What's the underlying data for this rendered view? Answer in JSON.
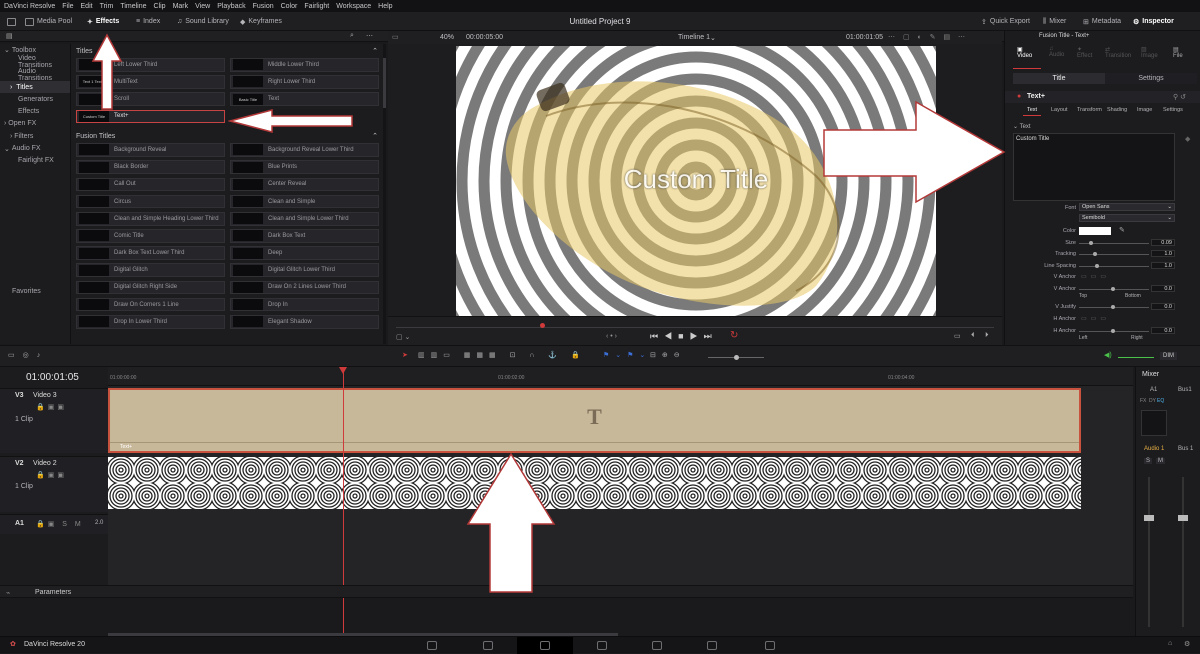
{
  "menubar": {
    "items": [
      "DaVinci Resolve",
      "File",
      "Edit",
      "Trim",
      "Timeline",
      "Clip",
      "Mark",
      "View",
      "Playback",
      "Fusion",
      "Color",
      "Fairlight",
      "Workspace",
      "Help"
    ]
  },
  "toolbar": {
    "media_pool": "Media Pool",
    "effects": "Effects",
    "index": "Index",
    "sound_library": "Sound Library",
    "keyframes": "Keyframes",
    "project_title": "Untitled Project 9",
    "quick_export": "Quick Export",
    "mixer": "Mixer",
    "metadata": "Metadata",
    "inspector": "Inspector"
  },
  "toolbox": {
    "items": [
      {
        "label": "Toolbox",
        "indent": 0
      },
      {
        "label": "Video Transitions",
        "indent": 1
      },
      {
        "label": "Audio Transitions",
        "indent": 1
      },
      {
        "label": "Titles",
        "indent": 1,
        "selected": true
      },
      {
        "label": "Generators",
        "indent": 1
      },
      {
        "label": "Effects",
        "indent": 1
      },
      {
        "label": "Open FX",
        "indent": 0
      },
      {
        "label": "Filters",
        "indent": 1
      },
      {
        "label": "Audio FX",
        "indent": 0
      },
      {
        "label": "Fairlight FX",
        "indent": 1
      }
    ],
    "favorites": "Favorites"
  },
  "effects_panel": {
    "titles_header": "Titles",
    "titles": [
      {
        "label": "Left Lower Third",
        "thumb": ""
      },
      {
        "label": "Middle Lower Third",
        "thumb": ""
      },
      {
        "label": "MultiText",
        "thumb": "Text 1 Text 2"
      },
      {
        "label": "Right Lower Third",
        "thumb": ""
      },
      {
        "label": "Scroll",
        "thumb": ""
      },
      {
        "label": "Text",
        "thumb": "Basic Title"
      },
      {
        "label": "Text+",
        "thumb": "Custom Title",
        "selected": true
      }
    ],
    "fusion_header": "Fusion Titles",
    "fusion_titles": [
      "Background Reveal",
      "Background Reveal Lower Third",
      "Black Border",
      "Blue Prints",
      "Call Out",
      "Center Reveal",
      "Circus",
      "Clean and Simple",
      "Clean and Simple Heading Lower Third",
      "Clean and Simple Lower Third",
      "Comic Title",
      "Dark Box Text",
      "Dark Box Text Lower Third",
      "Deep",
      "Digital Glitch",
      "Digital Glitch Lower Third",
      "Digital Glitch Right Side",
      "Draw On 2 Lines Lower Third",
      "Draw On Corners 1 Line",
      "Drop In",
      "Drop In Lower Third",
      "Elegant Shadow"
    ]
  },
  "viewer": {
    "zoom": "40%",
    "timecode_left": "00:00:05:00",
    "timeline_name": "Timeline 1",
    "timecode_right": "01:00:01:05",
    "overlay_text": "Custom Title"
  },
  "inspector": {
    "header": "Fusion Title - Text+",
    "top_tabs": [
      "Video",
      "Audio",
      "Effect",
      "Transition",
      "Image",
      "File"
    ],
    "sub_tabs": [
      "Title",
      "Settings"
    ],
    "tool_name": "Text+",
    "tool_tabs": [
      "Text",
      "Layout",
      "Transform",
      "Shading",
      "Image",
      "Settings"
    ],
    "section": "Text",
    "styled_text": "Custom Title",
    "font_label": "Font",
    "font_value": "Open Sans",
    "style_value": "Semibold",
    "color_label": "Color",
    "size_label": "Size",
    "size_value": "0.09",
    "tracking_label": "Tracking",
    "tracking_value": "1.0",
    "spacing_label": "Line Spacing",
    "spacing_value": "1.0",
    "vanchor_label": "V Anchor",
    "vanchor2_label": "V Anchor",
    "vanchor2_value": "0.0",
    "top_label": "Top",
    "bottom_label": "Bottom",
    "vjustify_label": "V Justify",
    "vjustify_value": "0.0",
    "hanchor_label": "H Anchor",
    "hanchor2_label": "H Anchor",
    "hanchor2_value": "0.0",
    "left_label": "Left",
    "right_label": "Right"
  },
  "timeline": {
    "timecode": "01:00:01:05",
    "ruler": [
      "01:00:00:00",
      "01:00:02:00",
      "01:00:04:00"
    ],
    "tracks": [
      {
        "id": "V3",
        "name": "Video 3",
        "clips": "1 Clip"
      },
      {
        "id": "V2",
        "name": "Video 2",
        "clips": "1 Clip"
      },
      {
        "id": "A1",
        "name": "",
        "clips": "",
        "extra": "2.0"
      }
    ],
    "v3_clip_label": "Text+",
    "v3_clip_glyph": "T",
    "parameters": "Parameters",
    "dim": "DIM"
  },
  "mixer": {
    "title": "Mixer",
    "a1": "A1",
    "bus1": "Bus1",
    "audio1": "Audio 1",
    "bus1b": "Bus 1",
    "fx": "FX",
    "dy": "DY",
    "eq": "EQ",
    "s": "S",
    "m": "M",
    "db": [
      "0.0",
      "0.0",
      "5",
      "10",
      "15",
      "20",
      "30",
      "40",
      "50"
    ]
  },
  "bottom": {
    "brand": "DaVinci Resolve 20"
  },
  "colors": {
    "accent": "#d03a3a",
    "arrow_border": "#b33838",
    "v3_clip": "#c8b89a",
    "selection": "#c74444"
  }
}
